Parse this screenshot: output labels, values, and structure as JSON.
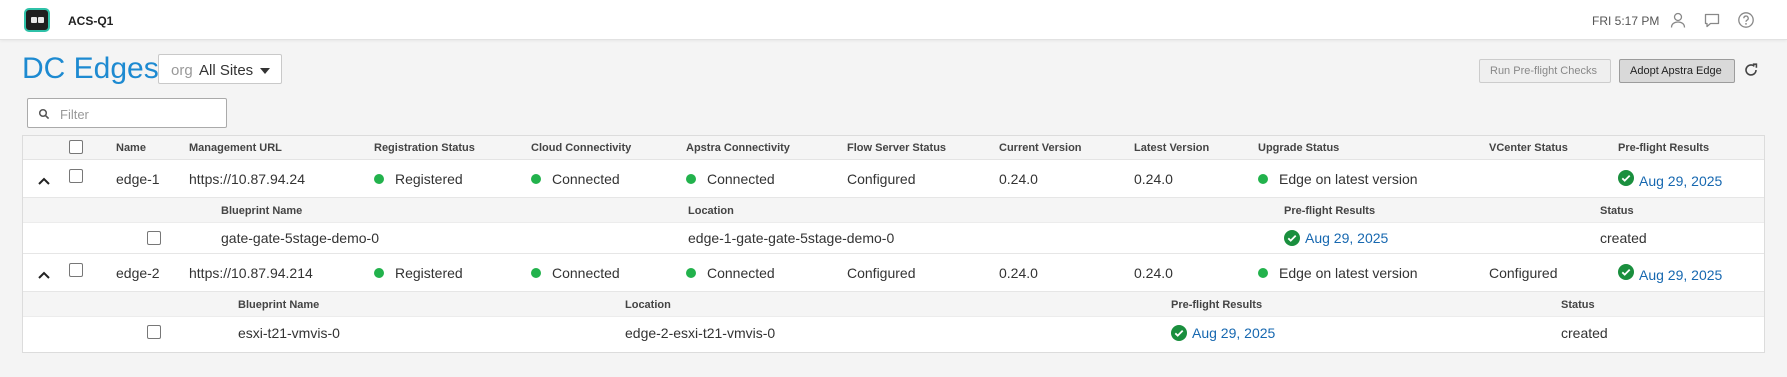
{
  "app": {
    "title": "ACS-Q1",
    "clock": "FRI 5:17 PM"
  },
  "header": {
    "page_title": "DC Edges",
    "site_select": {
      "prefix": "org",
      "value": "All Sites"
    },
    "run_preflight_label": "Run Pre-flight Checks",
    "adopt_label": "Adopt Apstra Edge"
  },
  "filter": {
    "placeholder": "Filter",
    "value": ""
  },
  "colors": {
    "accent": "#1d8ad1",
    "status_green": "#22b24c",
    "check_green": "#1a8f3e",
    "link": "#1768b0"
  },
  "icons": [
    "user-icon",
    "chat-icon",
    "help-icon",
    "refresh-icon",
    "search-icon",
    "chevron-up-icon",
    "check-circle-icon"
  ],
  "table": {
    "columns": [
      "Name",
      "Management URL",
      "Registration Status",
      "Cloud Connectivity",
      "Apstra Connectivity",
      "Flow Server Status",
      "Current Version",
      "Latest Version",
      "Upgrade Status",
      "VCenter Status",
      "Pre-flight Results"
    ],
    "sub_columns": [
      "Blueprint Name",
      "Location",
      "Pre-flight Results",
      "Status"
    ],
    "rows": [
      {
        "name": "edge-1",
        "url": "https://10.87.94.24",
        "registration": "Registered",
        "cloud": "Connected",
        "apstra": "Connected",
        "flow": "Configured",
        "current": "0.24.0",
        "latest": "0.24.0",
        "upgrade": "Edge on latest version",
        "vcenter": "",
        "preflight": "Aug 29, 2025",
        "blueprint": {
          "name": "gate-gate-5stage-demo-0",
          "location": "edge-1-gate-gate-5stage-demo-0",
          "preflight": "Aug 29, 2025",
          "status": "created"
        }
      },
      {
        "name": "edge-2",
        "url": "https://10.87.94.214",
        "registration": "Registered",
        "cloud": "Connected",
        "apstra": "Connected",
        "flow": "Configured",
        "current": "0.24.0",
        "latest": "0.24.0",
        "upgrade": "Edge on latest version",
        "vcenter": "Configured",
        "preflight": "Aug 29, 2025",
        "blueprint": {
          "name": "esxi-t21-vmvis-0",
          "location": "edge-2-esxi-t21-vmvis-0",
          "preflight": "Aug 29, 2025",
          "status": "created"
        }
      }
    ]
  }
}
